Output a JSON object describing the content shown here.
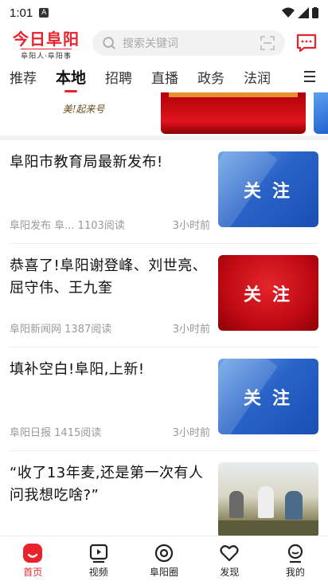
{
  "status_bar": {
    "time": "1:01",
    "a_badge": "A"
  },
  "header": {
    "logo_main": "今日阜阳",
    "logo_sub": "阜阳人·阜阳事",
    "search_placeholder": "搜索关键词"
  },
  "tabs": [
    {
      "label": "推荐",
      "active": false
    },
    {
      "label": "本地",
      "active": true
    },
    {
      "label": "招聘",
      "active": false
    },
    {
      "label": "直播",
      "active": false
    },
    {
      "label": "政务",
      "active": false
    },
    {
      "label": "法润",
      "active": false
    }
  ],
  "banner": {
    "left_text": "美!起来号"
  },
  "feed": [
    {
      "title": "阜阳市教育局最新发布!",
      "source": "阜阳发布 阜...",
      "reads": "1103阅读",
      "time": "3小时前",
      "thumb": "blue",
      "thumb_label": "关注"
    },
    {
      "title": "恭喜了!阜阳谢登峰、刘世亮、屈守伟、王九奎",
      "source": "阜阳新闻网",
      "reads": "1387阅读",
      "time": "3小时前",
      "thumb": "red",
      "thumb_label": "关注"
    },
    {
      "title": "填补空白!阜阳,上新!",
      "source": "阜阳日报",
      "reads": "1415阅读",
      "time": "3小时前",
      "thumb": "blue",
      "thumb_label": "关注"
    },
    {
      "title": "“收了13年麦,还是第一次有人问我想吃啥?”",
      "source": "",
      "reads": "",
      "time": "",
      "thumb": "photo",
      "thumb_label": ""
    }
  ],
  "bottom_nav": [
    {
      "label": "首页",
      "icon": "home-icon",
      "active": true
    },
    {
      "label": "视频",
      "icon": "video-icon",
      "active": false
    },
    {
      "label": "阜阳圈",
      "icon": "circle-icon",
      "active": false
    },
    {
      "label": "发现",
      "icon": "heart-icon",
      "active": false
    },
    {
      "label": "我的",
      "icon": "profile-icon",
      "active": false
    }
  ],
  "colors": {
    "accent": "#e8232b"
  }
}
